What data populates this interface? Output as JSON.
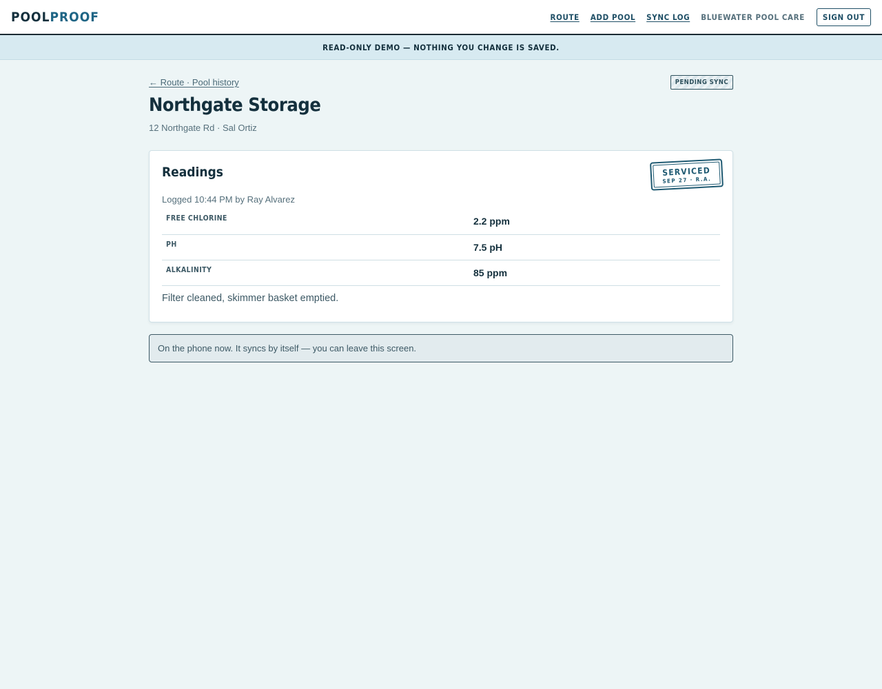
{
  "header": {
    "brand_part1": "POOL",
    "brand_part2": "PROOF",
    "nav": {
      "route": "ROUTE",
      "add_pool": "ADD POOL",
      "sync_log": "SYNC LOG",
      "company": "BLUEWATER POOL CARE",
      "sign_out": "SIGN OUT"
    }
  },
  "banner": {
    "text": "READ-ONLY DEMO — NOTHING YOU CHANGE IS SAVED."
  },
  "page": {
    "breadcrumb": "← Route · Pool history",
    "status_badge": "PENDING SYNC",
    "title": "Northgate Storage",
    "subtitle": "12 Northgate Rd · Sal Ortiz"
  },
  "readings_card": {
    "title": "Readings",
    "stamp": {
      "main": "SERVICED",
      "sub": "SEP 27 · R.A."
    },
    "logged": "Logged 10:44 PM by Ray Alvarez",
    "rows": [
      {
        "label": "FREE CHLORINE",
        "value": "2.2 ppm"
      },
      {
        "label": "PH",
        "value": "7.5 pH"
      },
      {
        "label": "ALKALINITY",
        "value": "85 ppm"
      }
    ],
    "note": "Filter cleaned, skimmer basket emptied."
  },
  "sync_message": "On the phone now. It syncs by itself — you can leave this screen.",
  "colors": {
    "background": "#edf5f6",
    "brand_dark": "#14303d",
    "brand_accent": "#1f6585",
    "banner": "#d7eaf1"
  }
}
